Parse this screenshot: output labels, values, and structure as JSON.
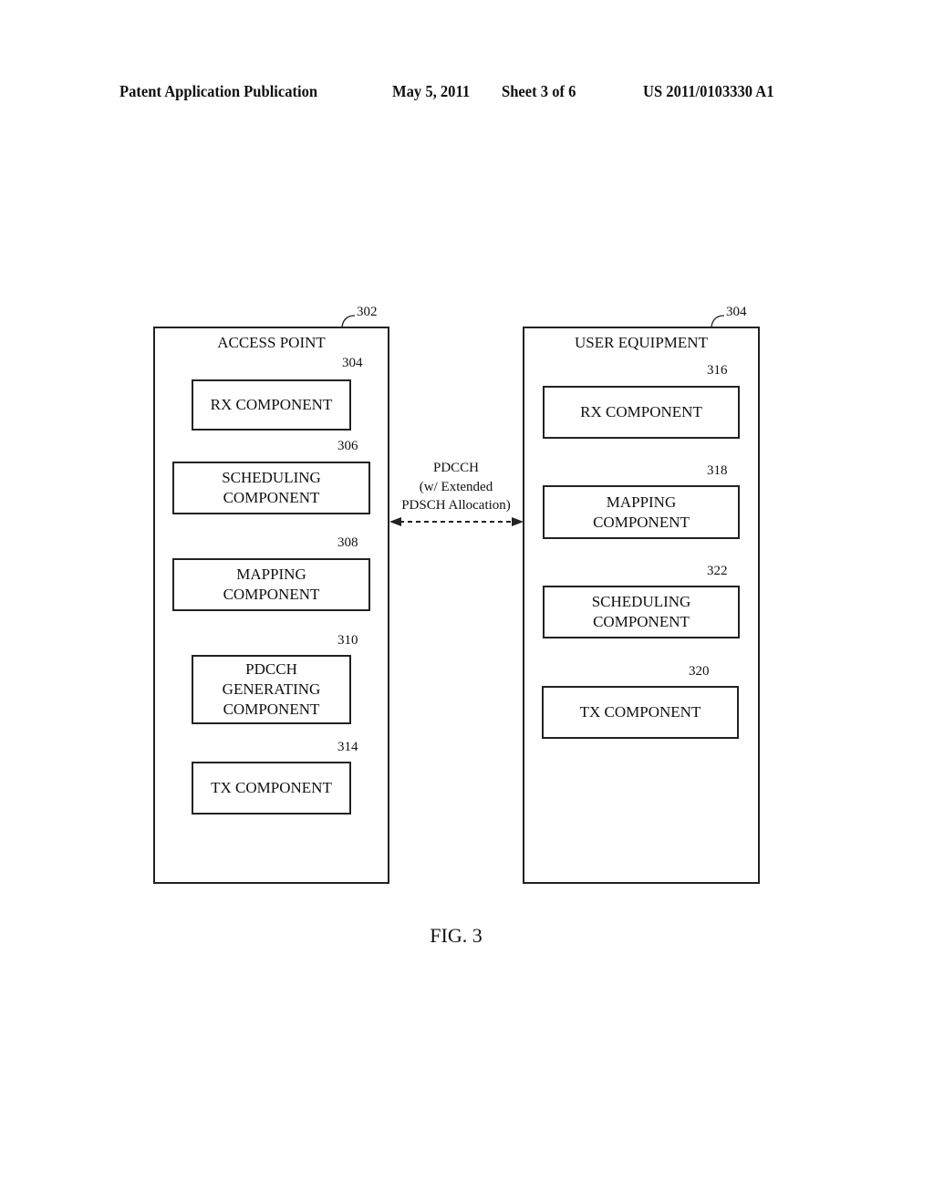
{
  "header": {
    "publication": "Patent Application Publication",
    "date": "May 5, 2011",
    "sheet": "Sheet 3 of 6",
    "number": "US 2011/0103330 A1"
  },
  "access_point": {
    "ref": "302",
    "title": "ACCESS POINT",
    "components": [
      {
        "ref": "304",
        "label": "RX COMPONENT"
      },
      {
        "ref": "306",
        "label": "SCHEDULING\nCOMPONENT"
      },
      {
        "ref": "308",
        "label": "MAPPING\nCOMPONENT"
      },
      {
        "ref": "310",
        "label": "PDCCH\nGENERATING\nCOMPONENT"
      },
      {
        "ref": "314",
        "label": "TX COMPONENT"
      }
    ]
  },
  "user_equipment": {
    "ref": "304",
    "title": "USER EQUIPMENT",
    "components": [
      {
        "ref": "316",
        "label": "RX COMPONENT"
      },
      {
        "ref": "318",
        "label": "MAPPING\nCOMPONENT"
      },
      {
        "ref": "322",
        "label": "SCHEDULING\nCOMPONENT"
      },
      {
        "ref": "320",
        "label": "TX COMPONENT"
      }
    ]
  },
  "link": {
    "label": "PDCCH\n(w/ Extended\nPDSCH Allocation)",
    "style": "dashed-bidirectional"
  },
  "figure_label": "FIG. 3"
}
